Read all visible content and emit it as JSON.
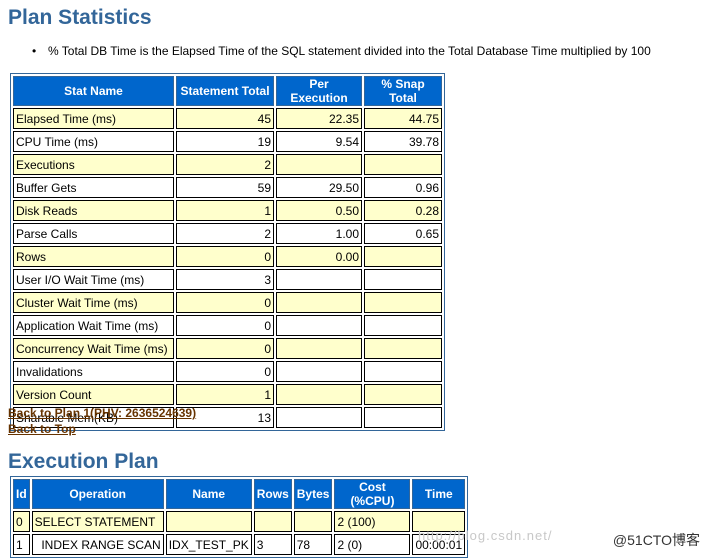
{
  "plan_statistics": {
    "heading": "Plan Statistics",
    "note": "% Total DB Time is the Elapsed Time of the SQL statement divided into the Total Database Time multiplied by 100",
    "columns": [
      "Stat Name",
      "Statement Total",
      "Per Execution",
      "% Snap Total"
    ],
    "rows": [
      [
        "Elapsed Time (ms)",
        "45",
        "22.35",
        "44.75"
      ],
      [
        "CPU Time (ms)",
        "19",
        "9.54",
        "39.78"
      ],
      [
        "Executions",
        "2",
        "",
        ""
      ],
      [
        "Buffer Gets",
        "59",
        "29.50",
        "0.96"
      ],
      [
        "Disk Reads",
        "1",
        "0.50",
        "0.28"
      ],
      [
        "Parse Calls",
        "2",
        "1.00",
        "0.65"
      ],
      [
        "Rows",
        "0",
        "0.00",
        ""
      ],
      [
        "User I/O Wait Time (ms)",
        "3",
        "",
        ""
      ],
      [
        "Cluster Wait Time (ms)",
        "0",
        "",
        ""
      ],
      [
        "Application Wait Time (ms)",
        "0",
        "",
        ""
      ],
      [
        "Concurrency Wait Time (ms)",
        "0",
        "",
        ""
      ],
      [
        "Invalidations",
        "0",
        "",
        ""
      ],
      [
        "Version Count",
        "1",
        "",
        ""
      ],
      [
        "Sharable Mem(KB)",
        "13",
        "",
        ""
      ]
    ]
  },
  "links": {
    "back_to_plan": "Back to Plan 1(PHV: 2636524639)",
    "back_to_top": "Back to Top"
  },
  "execution_plan": {
    "heading": "Execution Plan",
    "columns": [
      "Id",
      "Operation",
      "Name",
      "Rows",
      "Bytes",
      "Cost (%CPU)",
      "Time"
    ],
    "rows": [
      [
        "0",
        "SELECT STATEMENT",
        "",
        "",
        "",
        "2 (100)",
        ""
      ],
      [
        "1",
        "  INDEX RANGE SCAN",
        "IDX_TEST_PK",
        "3",
        "78",
        "2 (0)",
        "00:00:01"
      ]
    ]
  },
  "watermark": {
    "url_text": "http://blog.csdn.net/",
    "brand": "@51CTO博客"
  },
  "colors": {
    "heading": "#336699",
    "header_bg": "#0066cc",
    "odd_row_bg": "#ffffcc",
    "link": "#663300"
  }
}
